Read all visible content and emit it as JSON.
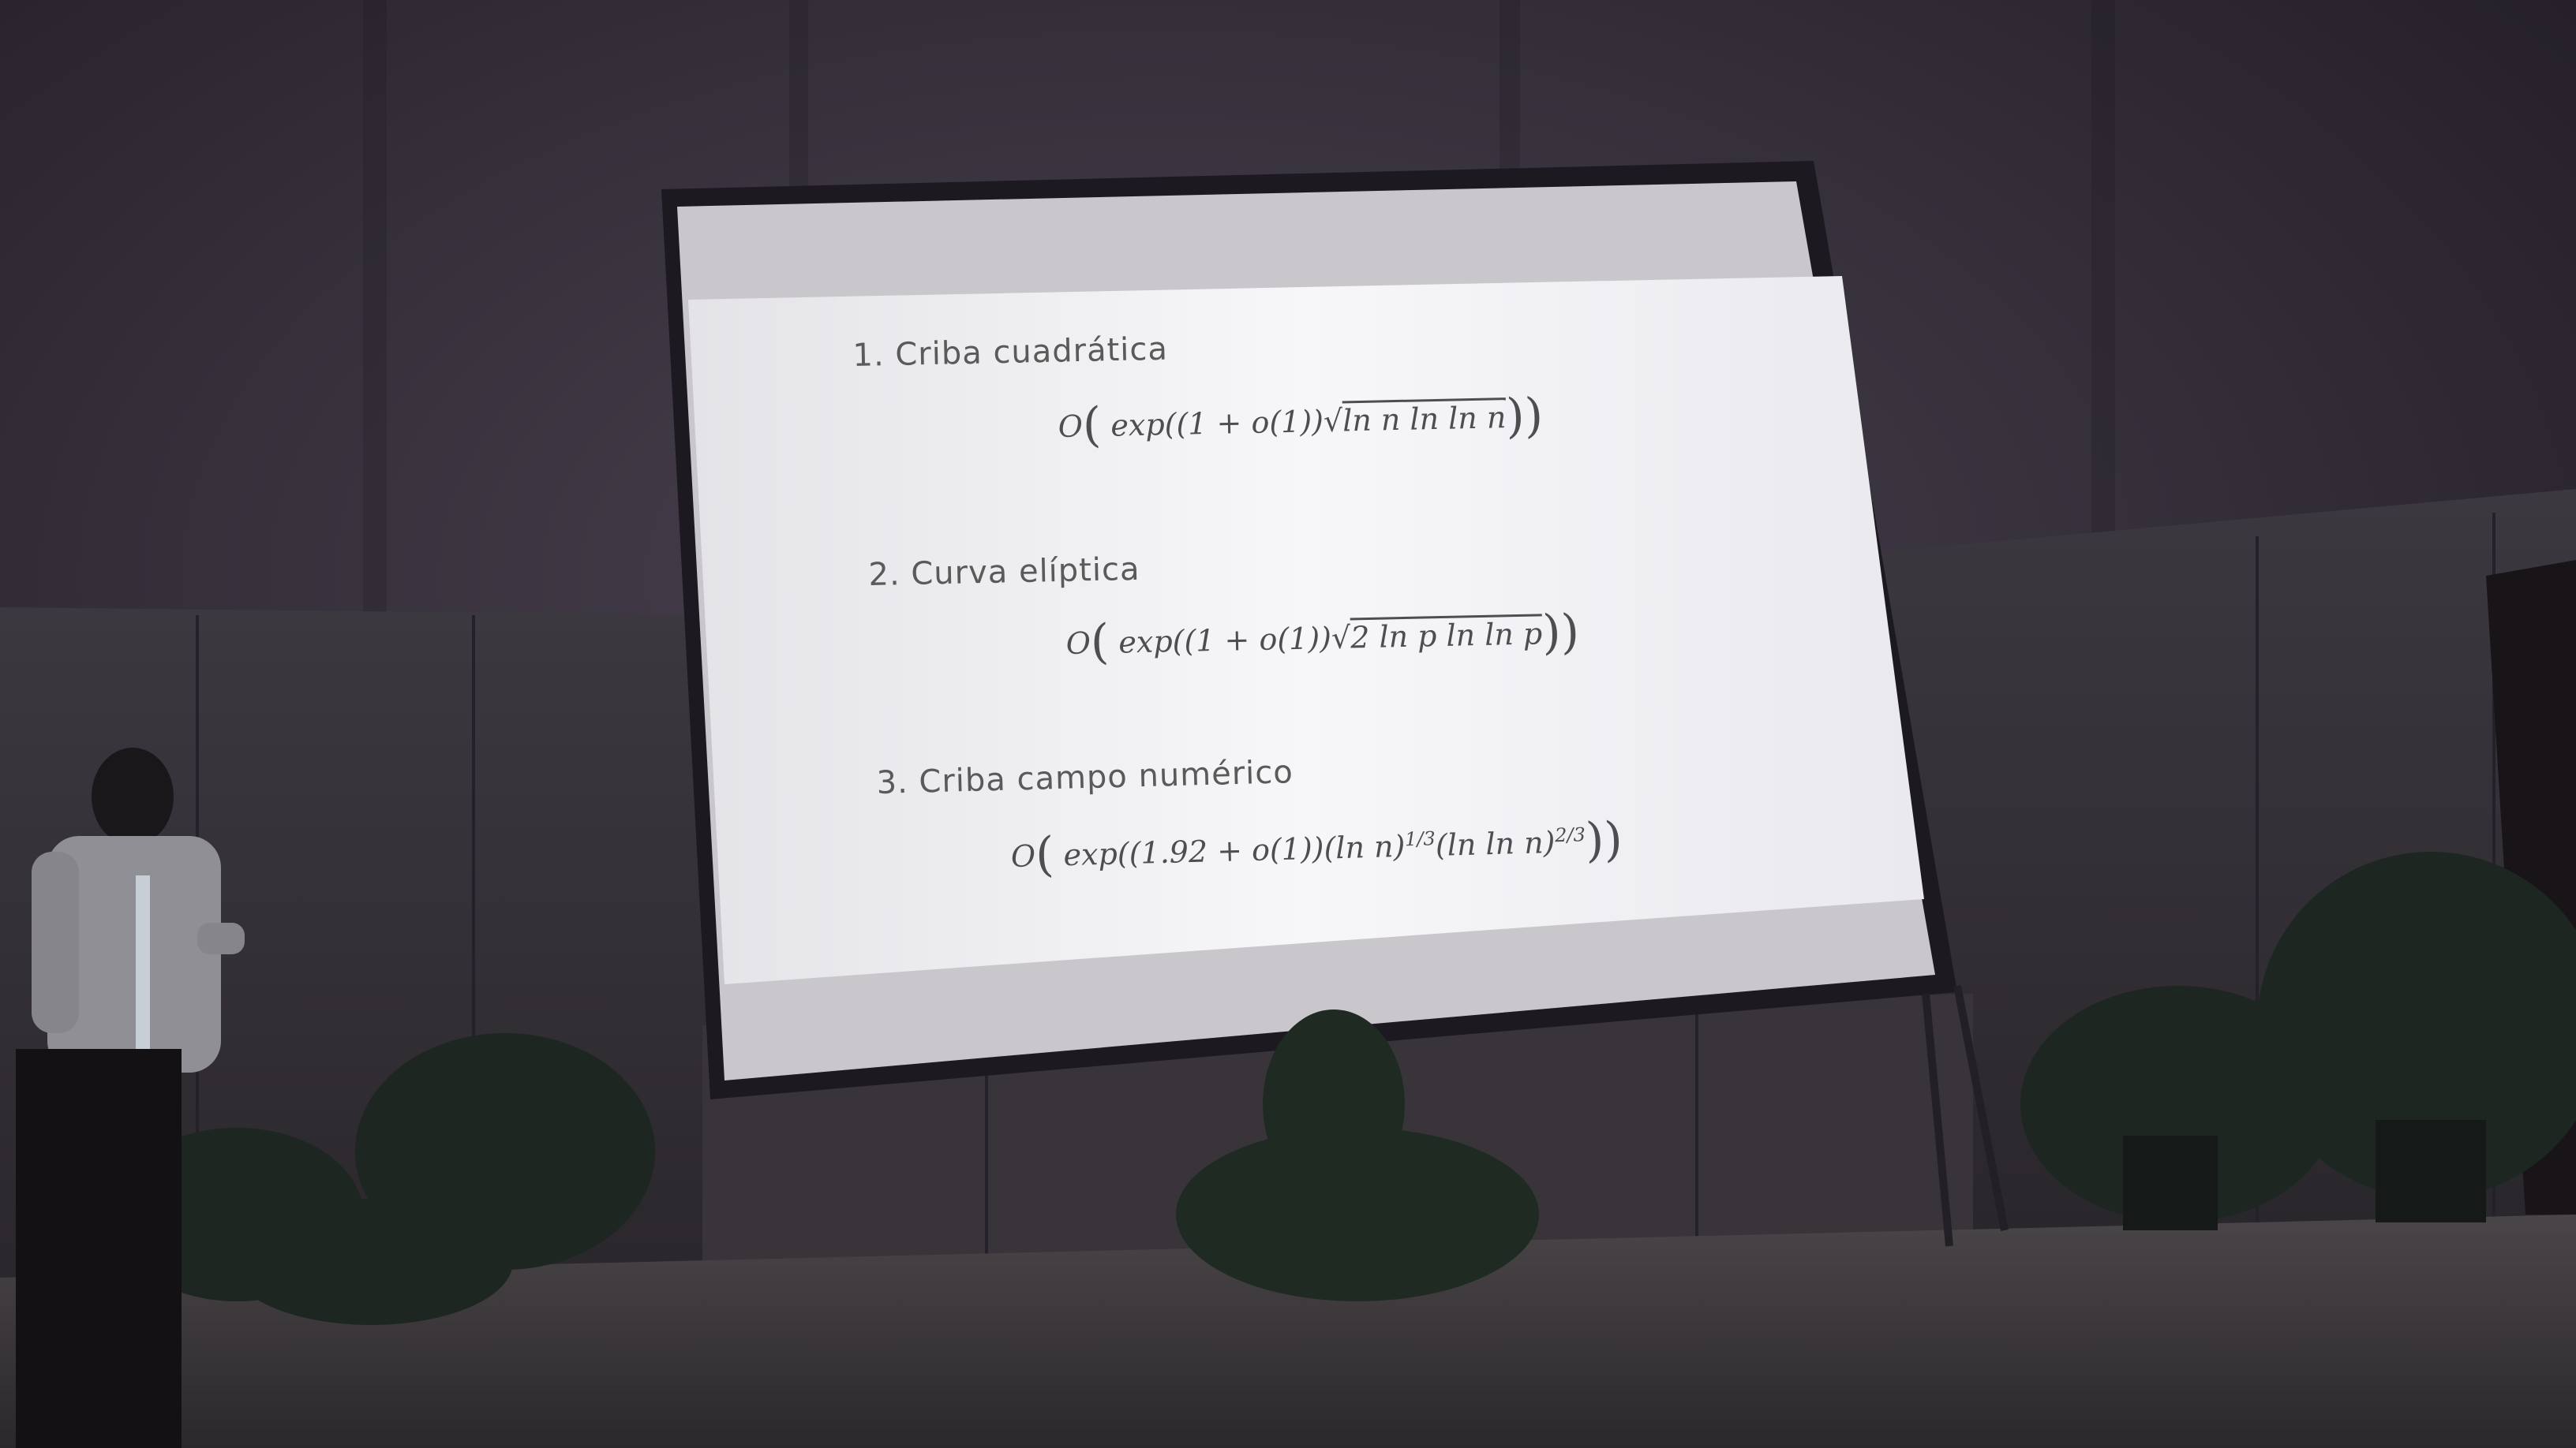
{
  "slide": {
    "items": [
      {
        "title": "1. Criba cuadrática",
        "formula_prefix": "O",
        "formula_body": "exp((1 + o(1))",
        "formula_radical_sign": "√",
        "formula_radicand": "ln n ln ln n",
        "formula_suffix": "))"
      },
      {
        "title": "2. Curva elíptica",
        "formula_prefix": "O",
        "formula_body": "exp((1 + o(1))",
        "formula_radical_sign": "√",
        "formula_radicand": "2 ln p ln ln p",
        "formula_suffix": "))"
      },
      {
        "title": "3.  Criba campo numérico",
        "formula_prefix": "O",
        "formula_body": "exp((1.92 + o(1))(ln n)",
        "formula_exp1": "1/3",
        "formula_mid": "(ln ln n)",
        "formula_exp2": "2/3",
        "formula_suffix": "))"
      }
    ]
  },
  "colors": {
    "room_wall": "#3a3340",
    "screen_light": "#f2f2f4",
    "screen_frame": "#1e1c22",
    "stage_floor": "#3e3a3e",
    "plants": "#1f2a22"
  }
}
